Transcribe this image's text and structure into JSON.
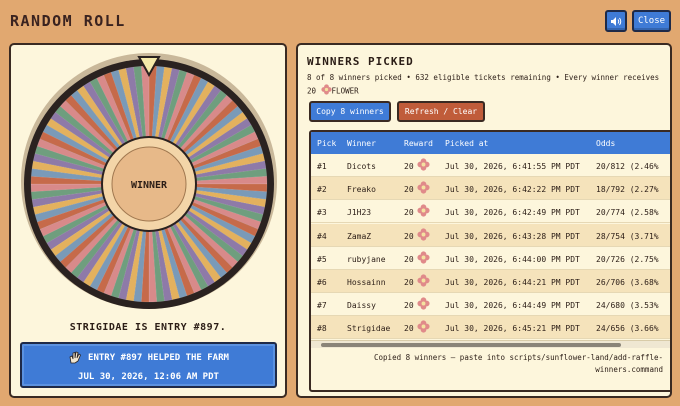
{
  "app": {
    "title": "RANDOM ROLL",
    "close_label": "Close",
    "sound_icon": "speaker-icon"
  },
  "wheel": {
    "center_label": "WINNER",
    "segment_colors": [
      "#c66a4a",
      "#7a9ab8",
      "#e3b15e",
      "#8e7aa8",
      "#6f9e7e",
      "#d88a8a"
    ]
  },
  "result": {
    "text": "STRIGIDAE IS ENTRY #897.",
    "announce_line1": "ENTRY #897 HELPED THE FARM",
    "announce_line2": "JUL 30, 2026, 12:06 AM PDT",
    "announce_icon": "hand-wave-icon"
  },
  "winners": {
    "title": "WINNERS PICKED",
    "summary_before": "8 of 8 winners picked • 632 eligible tickets remaining • Every winner receives 20",
    "summary_after": "FLOWER",
    "copy_label": "Copy 8 winners",
    "refresh_label": "Refresh / Clear",
    "columns": [
      "Pick",
      "Winner",
      "Reward",
      "Picked at",
      "Odds"
    ],
    "rows": [
      {
        "pick": "#1",
        "winner": "Dicots",
        "reward": "20",
        "picked_at": "Jul 30, 2026, 6:41:55 PM PDT",
        "odds": "20/812 (2.46%"
      },
      {
        "pick": "#2",
        "winner": "Freako",
        "reward": "20",
        "picked_at": "Jul 30, 2026, 6:42:22 PM PDT",
        "odds": "18/792 (2.27%"
      },
      {
        "pick": "#3",
        "winner": "J1H23",
        "reward": "20",
        "picked_at": "Jul 30, 2026, 6:42:49 PM PDT",
        "odds": "20/774 (2.58%"
      },
      {
        "pick": "#4",
        "winner": "ZamaZ",
        "reward": "20",
        "picked_at": "Jul 30, 2026, 6:43:28 PM PDT",
        "odds": "28/754 (3.71%"
      },
      {
        "pick": "#5",
        "winner": "rubyjane",
        "reward": "20",
        "picked_at": "Jul 30, 2026, 6:44:00 PM PDT",
        "odds": "20/726 (2.75%"
      },
      {
        "pick": "#6",
        "winner": "Hossainn",
        "reward": "20",
        "picked_at": "Jul 30, 2026, 6:44:21 PM PDT",
        "odds": "26/706 (3.68%"
      },
      {
        "pick": "#7",
        "winner": "Daissy",
        "reward": "20",
        "picked_at": "Jul 30, 2026, 6:44:49 PM PDT",
        "odds": "24/680 (3.53%"
      },
      {
        "pick": "#8",
        "winner": "Strigidae",
        "reward": "20",
        "picked_at": "Jul 30, 2026, 6:45:21 PM PDT",
        "odds": "24/656 (3.66%"
      }
    ],
    "footer_note": "Copied 8 winners — paste into scripts/sunflower-land/add-raffle-winners.command"
  }
}
